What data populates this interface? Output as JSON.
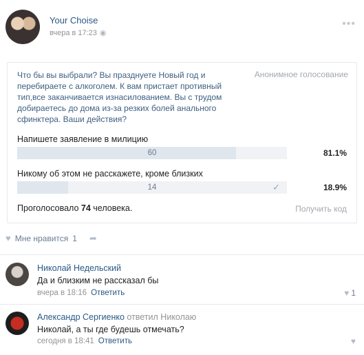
{
  "post": {
    "author": "Your Choise",
    "date": "вчера в 17:23",
    "menu_icon": "dots-icon"
  },
  "poll": {
    "question": "Что бы вы выбрали? Вы празднуете Новый год и перебираете с алкоголем. К вам пристает противный тип,все заканчивается изнасилованием. Вы с трудом добираетесь до дома из-за резких болей анального сфинктера. Ваши действия?",
    "type": "Анонимное голосование",
    "options": [
      {
        "label": "Напишете заявление в милицию",
        "count": "60",
        "percent": "81.1%",
        "fraction": 0.811,
        "voted": false
      },
      {
        "label": "Никому об этом не расскажете, кроме близких",
        "count": "14",
        "percent": "18.9%",
        "fraction": 0.189,
        "voted": true
      }
    ],
    "total_prefix": "Проголосовало ",
    "total_count": "74",
    "total_suffix": " человека.",
    "code_link": "Получить код"
  },
  "likes": {
    "label": "Мне нравится",
    "count": "1"
  },
  "comments": [
    {
      "author": "Николай Недельский",
      "text": "Да и близким не рассказал бы",
      "date": "вчера в 18:16",
      "reply_label": "Ответить",
      "likes": "1"
    },
    {
      "author": "Александр Сергиенко",
      "replied_to": "ответил Николаю",
      "text": "Николай, а ты где будешь отмечать?",
      "date": "сегодня в 18:41",
      "reply_label": "Ответить"
    }
  ],
  "colors": {
    "link": "#2a5885",
    "muted": "#939393",
    "bar_fill": "#dfe6ee",
    "bar_track": "#f0f2f5"
  }
}
